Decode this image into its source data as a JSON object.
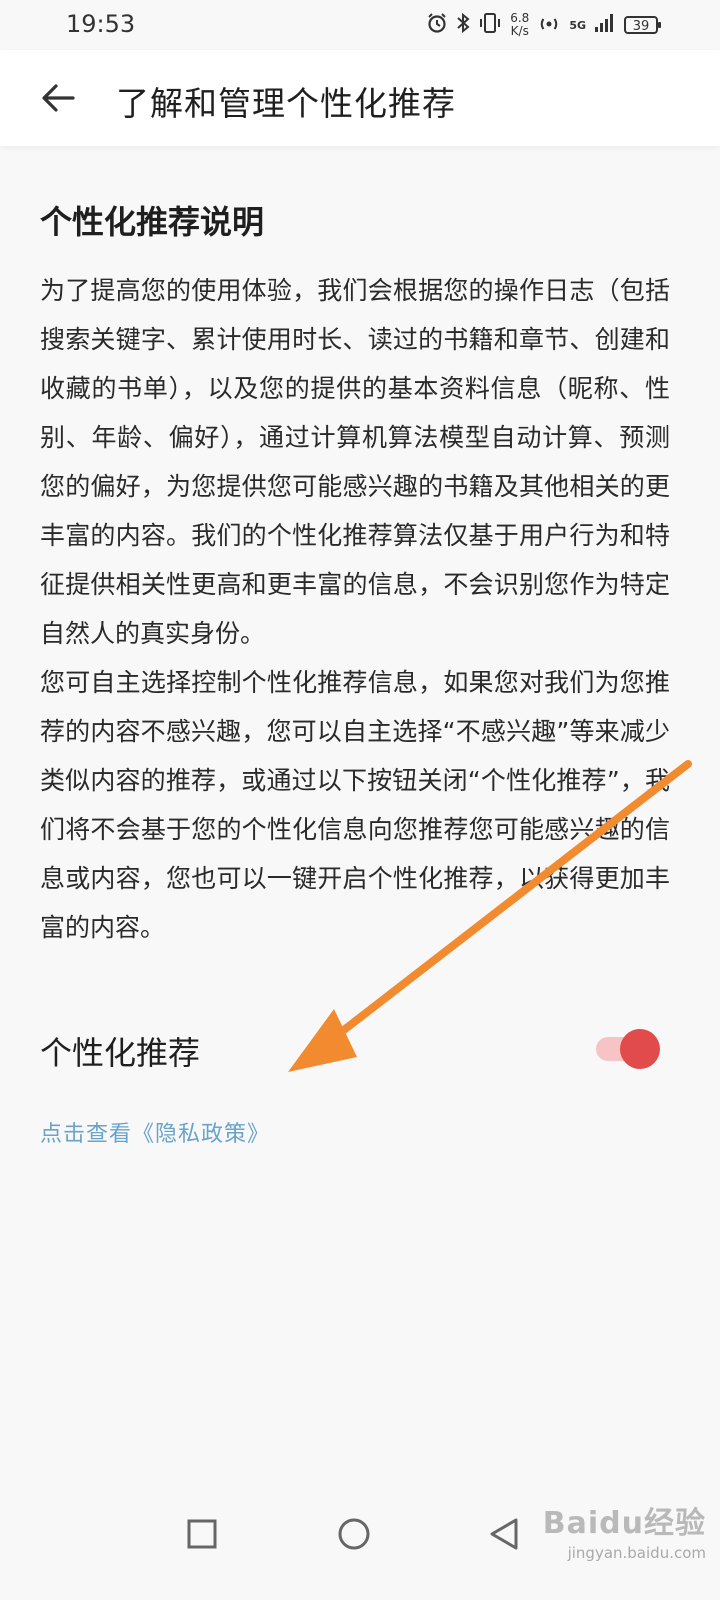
{
  "status_bar": {
    "time": "19:53",
    "net_speed_value": "6.8",
    "net_speed_unit": "K/s",
    "network": "5G",
    "battery": "39"
  },
  "header": {
    "title": "了解和管理个性化推荐"
  },
  "section": {
    "title": "个性化推荐说明",
    "paragraph1": "为了提高您的使用体验，我们会根据您的操作日志（包括搜索关键字、累计使用时长、读过的书籍和章节、创建和收藏的书单），以及您的提供的基本资料信息（昵称、性别、年龄、偏好），通过计算机算法模型自动计算、预测您的偏好，为您提供您可能感兴趣的书籍及其他相关的更丰富的内容。我们的个性化推荐算法仅基于用户行为和特征提供相关性更高和更丰富的信息，不会识别您作为特定自然人的真实身份。",
    "paragraph2": "您可自主选择控制个性化推荐信息，如果您对我们为您推荐的内容不感兴趣，您可以自主选择“不感兴趣”等来减少类似内容的推荐，或通过以下按钮关闭“个性化推荐”，我们将不会基于您的个性化信息向您推荐您可能感兴趣的信息或内容，您也可以一键开启个性化推荐，以获得更加丰富的内容。"
  },
  "toggle": {
    "label": "个性化推荐",
    "state": "on",
    "accent_color": "#e14b4b"
  },
  "privacy_link": {
    "label": "点击查看《隐私政策》"
  },
  "nav": {
    "icons": [
      "recent-apps-icon",
      "home-icon",
      "back-icon"
    ]
  },
  "watermark": {
    "brand": "Baidu经验",
    "url": "jingyan.baidu.com"
  },
  "annotation": {
    "arrow_color": "#f28b30"
  }
}
